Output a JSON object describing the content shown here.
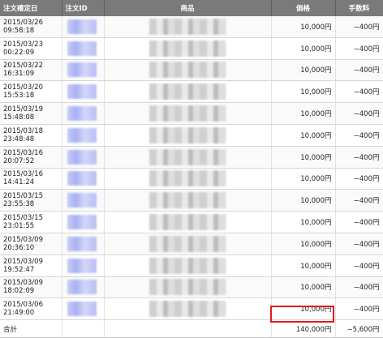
{
  "table": {
    "headers": {
      "date": "注文確定日",
      "order_id": "注文ID",
      "product": "商品",
      "price": "価格",
      "fee": "手数料"
    },
    "rows": [
      {
        "date": "2015/03/26",
        "time": "09:58:18",
        "price": "10,000円",
        "fee": "−400円"
      },
      {
        "date": "2015/03/23",
        "time": "00:22:09",
        "price": "10,000円",
        "fee": "−400円"
      },
      {
        "date": "2015/03/22",
        "time": "16:31:09",
        "price": "10,000円",
        "fee": "−400円"
      },
      {
        "date": "2015/03/20",
        "time": "15:53:18",
        "price": "10,000円",
        "fee": "−400円"
      },
      {
        "date": "2015/03/19",
        "time": "15:48:08",
        "price": "10,000円",
        "fee": "−400円"
      },
      {
        "date": "2015/03/18",
        "time": "23:48:48",
        "price": "10,000円",
        "fee": "−400円"
      },
      {
        "date": "2015/03/16",
        "time": "20:07:52",
        "price": "10,000円",
        "fee": "−400円"
      },
      {
        "date": "2015/03/16",
        "time": "14:41:24",
        "price": "10,000円",
        "fee": "−400円"
      },
      {
        "date": "2015/03/15",
        "time": "23:55:38",
        "price": "10,000円",
        "fee": "−400円"
      },
      {
        "date": "2015/03/15",
        "time": "23:01:55",
        "price": "10,000円",
        "fee": "−400円"
      },
      {
        "date": "2015/03/09",
        "time": "20:36:10",
        "price": "10,000円",
        "fee": "−400円"
      },
      {
        "date": "2015/03/09",
        "time": "19:52:47",
        "price": "10,000円",
        "fee": "−400円"
      },
      {
        "date": "2015/03/09",
        "time": "18:02:09",
        "price": "10,000円",
        "fee": "−400円"
      },
      {
        "date": "2015/03/06",
        "time": "21:49:00",
        "price": "10,000円",
        "fee": "−400円"
      }
    ],
    "footer": {
      "label": "合計",
      "price_total": "140,000円",
      "fee_total": "−5,600円"
    }
  },
  "colors": {
    "header_bg": "#7a7a7a",
    "highlight": "#e01b1b"
  }
}
